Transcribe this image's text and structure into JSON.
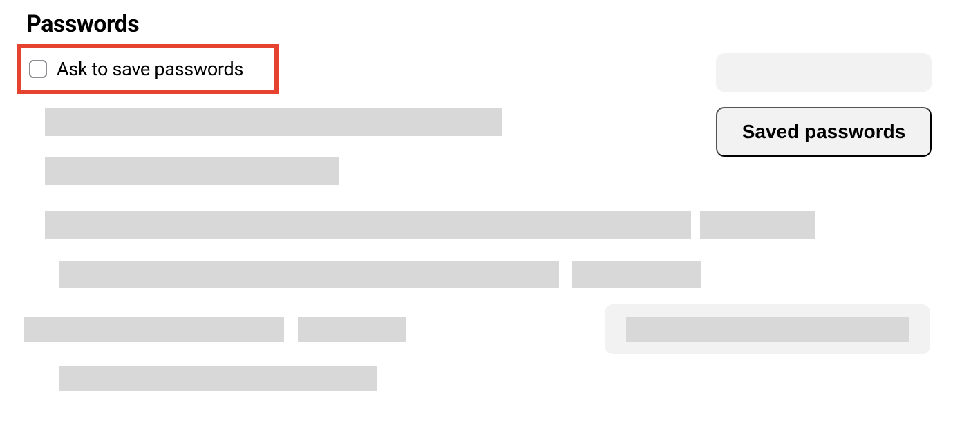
{
  "section": {
    "heading": "Passwords",
    "ask_to_save_label": "Ask to save passwords",
    "saved_passwords_button_label": "Saved passwords"
  }
}
